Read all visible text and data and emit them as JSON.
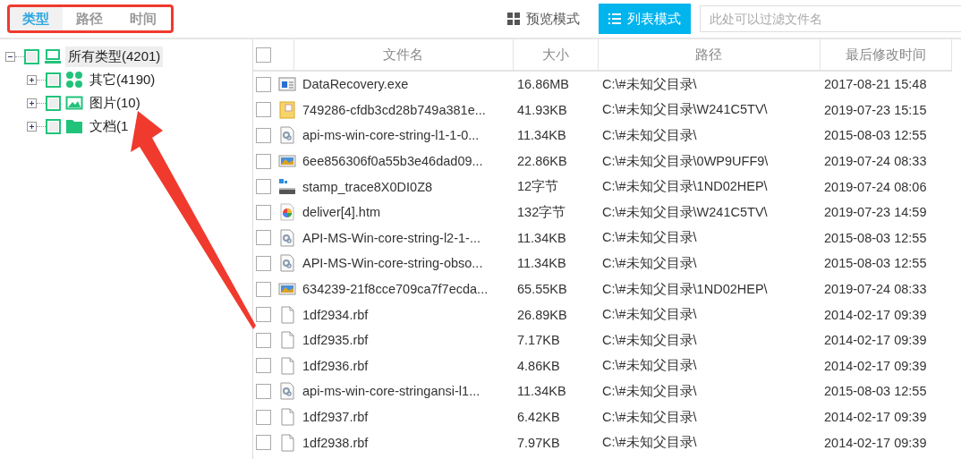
{
  "tabs": [
    {
      "label": "类型",
      "selected": true
    },
    {
      "label": "路径",
      "selected": false
    },
    {
      "label": "时间",
      "selected": false
    }
  ],
  "view_modes": [
    {
      "label": "预览模式",
      "kind": "grid",
      "selected": false
    },
    {
      "label": "列表模式",
      "kind": "list",
      "selected": true
    }
  ],
  "search": {
    "placeholder": "此处可以过滤文件名"
  },
  "tree": {
    "label": "所有类型(4201)",
    "kind": "computer",
    "checked": false,
    "expanded": true,
    "selected": true,
    "children": [
      {
        "label": "其它(4190)",
        "kind": "other",
        "checked": false,
        "expanded": false,
        "selected": false
      },
      {
        "label": "图片(10)",
        "kind": "image",
        "checked": false,
        "expanded": false,
        "selected": false
      },
      {
        "label": "文档(1",
        "kind": "folder",
        "checked": false,
        "expanded": false,
        "selected": false
      }
    ]
  },
  "table": {
    "select_all": {
      "checked": false
    },
    "columns": [
      "文件名",
      "大小",
      "路径",
      "最后修改时间"
    ],
    "rows": [
      {
        "kind": "exe",
        "name": "DataRecovery.exe",
        "size": "16.86MB",
        "path": "C:\\#未知父目录\\",
        "modified": "2017-08-21  15:48",
        "checked": false
      },
      {
        "kind": "archive",
        "name": "749286-cfdb3cd28b749a381e...",
        "size": "41.93KB",
        "path": "C:\\#未知父目录\\W241C5TV\\",
        "modified": "2019-07-23  15:15",
        "checked": false
      },
      {
        "kind": "dll",
        "name": "api-ms-win-core-string-l1-1-0...",
        "size": "11.34KB",
        "path": "C:\\#未知父目录\\",
        "modified": "2015-08-03  12:55",
        "checked": false
      },
      {
        "kind": "image",
        "name": "6ee856306f0a55b3e46dad09...",
        "size": "22.86KB",
        "path": "C:\\#未知父目录\\0WP9UFF9\\",
        "modified": "2019-07-24  08:33",
        "checked": false
      },
      {
        "kind": "drive",
        "name": "stamp_trace8X0DI0Z8",
        "size": "12字节",
        "path": "C:\\#未知父目录\\1ND02HEP\\",
        "modified": "2019-07-24  08:06",
        "checked": false
      },
      {
        "kind": "web",
        "name": "deliver[4].htm",
        "size": "132字节",
        "path": "C:\\#未知父目录\\W241C5TV\\",
        "modified": "2019-07-23  14:59",
        "checked": false
      },
      {
        "kind": "dll",
        "name": "API-MS-Win-core-string-l2-1-...",
        "size": "11.34KB",
        "path": "C:\\#未知父目录\\",
        "modified": "2015-08-03  12:55",
        "checked": false
      },
      {
        "kind": "dll",
        "name": "API-MS-Win-core-string-obso...",
        "size": "11.34KB",
        "path": "C:\\#未知父目录\\",
        "modified": "2015-08-03  12:55",
        "checked": false
      },
      {
        "kind": "image",
        "name": "634239-21f8cce709ca7f7ecda...",
        "size": "65.55KB",
        "path": "C:\\#未知父目录\\1ND02HEP\\",
        "modified": "2019-07-24  08:33",
        "checked": false
      },
      {
        "kind": "file",
        "name": "1df2934.rbf",
        "size": "26.89KB",
        "path": "C:\\#未知父目录\\",
        "modified": "2014-02-17  09:39",
        "checked": false
      },
      {
        "kind": "file",
        "name": "1df2935.rbf",
        "size": "7.17KB",
        "path": "C:\\#未知父目录\\",
        "modified": "2014-02-17  09:39",
        "checked": false
      },
      {
        "kind": "file",
        "name": "1df2936.rbf",
        "size": "4.86KB",
        "path": "C:\\#未知父目录\\",
        "modified": "2014-02-17  09:39",
        "checked": false
      },
      {
        "kind": "dll",
        "name": "api-ms-win-core-stringansi-l1...",
        "size": "11.34KB",
        "path": "C:\\#未知父目录\\",
        "modified": "2015-08-03  12:55",
        "checked": false
      },
      {
        "kind": "file",
        "name": "1df2937.rbf",
        "size": "6.42KB",
        "path": "C:\\#未知父目录\\",
        "modified": "2014-02-17  09:39",
        "checked": false
      },
      {
        "kind": "file",
        "name": "1df2938.rbf",
        "size": "7.97KB",
        "path": "C:\\#未知父目录\\",
        "modified": "2014-02-17  09:39",
        "checked": false
      }
    ]
  }
}
